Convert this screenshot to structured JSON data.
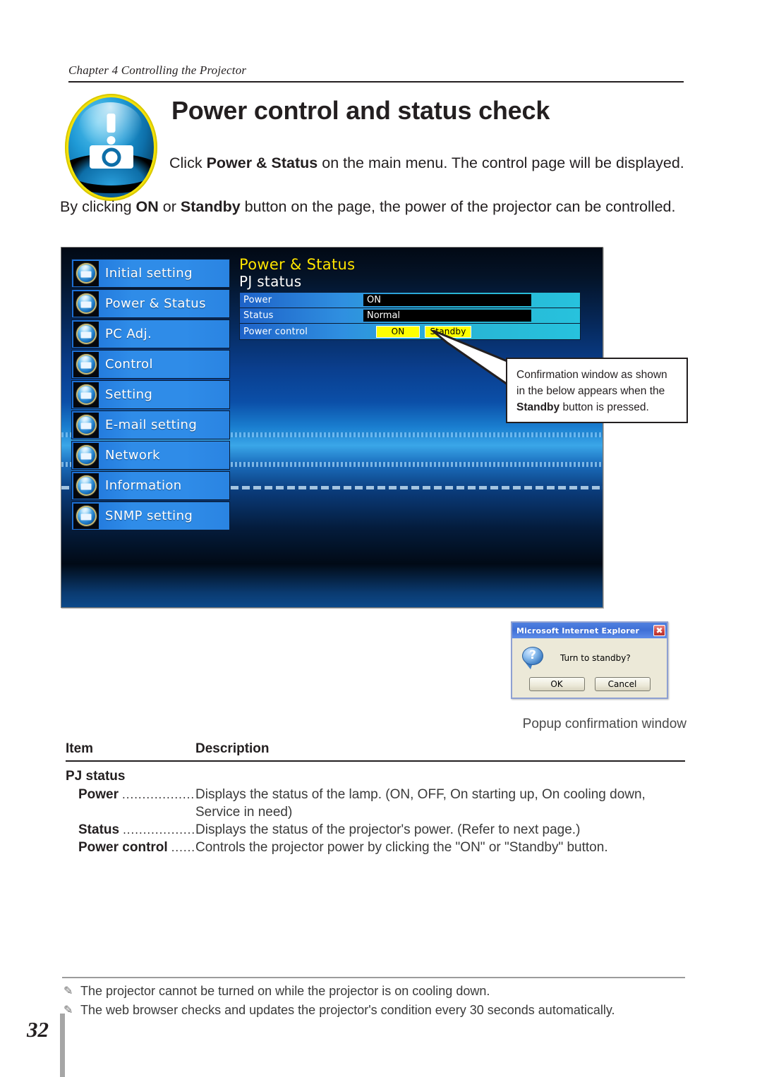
{
  "header": {
    "chapter": "Chapter 4 Controlling the Projector"
  },
  "section": {
    "title": "Power control and status check",
    "logo_icon": "projector-alert-icon",
    "paragraph1_pre": "Click ",
    "paragraph1_bold": "Power & Status",
    "paragraph1_post": " on the main menu. The control page will be displayed.",
    "paragraph2_pre": "By clicking ",
    "paragraph2_bold1": "ON",
    "paragraph2_mid": " or ",
    "paragraph2_bold2": "Standby",
    "paragraph2_post": " button on the page, the power of the projector can be controlled."
  },
  "screenshot": {
    "menu": [
      {
        "label": "Initial setting",
        "icon": "initial-setting-icon"
      },
      {
        "label": "Power & Status",
        "icon": "power-status-icon"
      },
      {
        "label": "PC Adj.",
        "icon": "pc-adj-icon"
      },
      {
        "label": "Control",
        "icon": "control-icon"
      },
      {
        "label": "Setting",
        "icon": "setting-icon"
      },
      {
        "label": "E-mail setting",
        "icon": "email-setting-icon"
      },
      {
        "label": "Network",
        "icon": "network-icon"
      },
      {
        "label": "Information",
        "icon": "information-icon"
      },
      {
        "label": "SNMP setting",
        "icon": "snmp-setting-icon"
      }
    ],
    "panel_title": "Power & Status",
    "panel_subtitle": "PJ status",
    "rows": [
      {
        "label": "Power",
        "value": "ON"
      },
      {
        "label": "Status",
        "value": "Normal"
      }
    ],
    "power_control_label": "Power control",
    "btn_on": "ON",
    "btn_standby": "Standby"
  },
  "callout": {
    "line1": "Confirmation window  as shown",
    "line2": "in the below appears  when the",
    "line3_bold": "Standby",
    "line3_rest": " button is pressed."
  },
  "dialog": {
    "title": "Microsoft Internet Explorer",
    "close_icon": "close-icon",
    "question_icon": "question-icon",
    "message": "Turn to standby?",
    "ok": "OK",
    "cancel": "Cancel"
  },
  "caption": "Popup confirmation window",
  "spec": {
    "col_item": "Item",
    "col_description": "Description",
    "group": "PJ status",
    "rows": [
      {
        "term": "Power",
        "leader": "........................",
        "desc": "Displays the status of the lamp. (ON, OFF, On starting up, On cooling down, Service in need)"
      },
      {
        "term": "Status",
        "leader": ".........................",
        "desc": "Displays the status of the projector's power. (Refer to next page.)"
      },
      {
        "term": "Power control",
        "leader": "........",
        "desc": "Controls the projector power by clicking the \"ON\" or \"Standby\" button."
      }
    ]
  },
  "footer": {
    "notes": [
      "The projector cannot be turned on while the projector is on cooling down.",
      "The web browser checks and updates the projector's condition every 30 seconds automatically."
    ],
    "note_icon": "pencil-icon",
    "page_number": "32"
  }
}
